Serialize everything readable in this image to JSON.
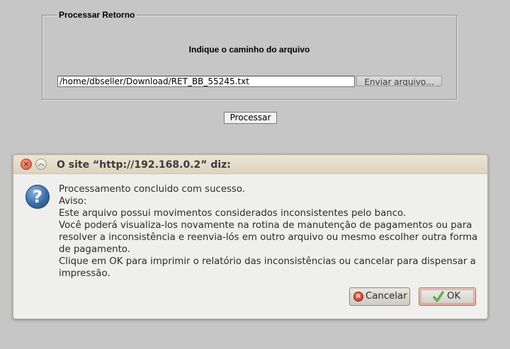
{
  "form": {
    "legend": "Processar Retorno",
    "instruction": "Indique o caminho do arquivo",
    "file_path": "/home/dbseller/Download/RET_BB_55245.txt",
    "browse_label": "Enviar arquivo...",
    "process_label": "Processar"
  },
  "dialog": {
    "title": "O site “http://192.168.0.2” diz:",
    "icon": "question-icon",
    "message_lines": [
      "Processamento concluido com sucesso.",
      "Aviso:",
      "Este arquivo possui movimentos considerados inconsistentes pelo banco.",
      "Você poderá visualiza-los novamente na rotina de manutenção de pagamentos ou para",
      "resolver a inconsistência e reenvia-lós em outro arquivo ou mesmo escolher outra forma",
      "de pagamento.",
      "Clique em OK para imprimir o relatório das inconsistências ou cancelar para dispensar a",
      "impressão."
    ],
    "cancel_label": "Cancelar",
    "ok_label": "OK"
  },
  "colors": {
    "page_background": "#c6c6c6",
    "dialog_background": "#efefed",
    "titlebar": "#e4dccb",
    "close_button": "#d9573a",
    "ok_highlight": "#e2ab9c",
    "question_icon": "#3a6ea8"
  }
}
